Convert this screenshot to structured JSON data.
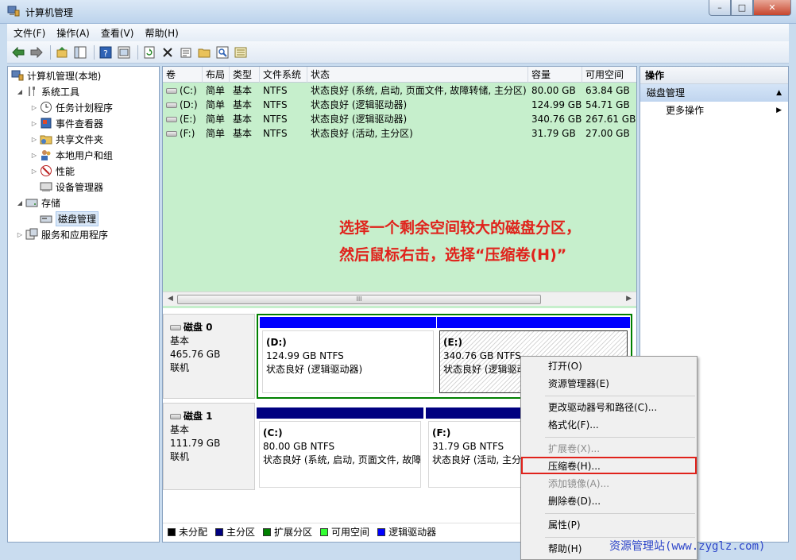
{
  "window": {
    "title": "计算机管理",
    "buttons": {
      "minimize": "–",
      "maximize": "□",
      "close": "✕"
    }
  },
  "menu": [
    "文件(F)",
    "操作(A)",
    "查看(V)",
    "帮助(H)"
  ],
  "toolbar": [
    "back-icon",
    "forward-icon",
    "up-icon",
    "console-tree-icon",
    "help-icon",
    "properties-icon",
    "refresh-icon",
    "delete-icon",
    "properties2-icon",
    "open-icon",
    "search-icon",
    "export-icon"
  ],
  "tree": {
    "root": "计算机管理(本地)",
    "system_tools": "系统工具",
    "task_scheduler": "任务计划程序",
    "event_viewer": "事件查看器",
    "shared_folders": "共享文件夹",
    "local_users": "本地用户和组",
    "performance": "性能",
    "device_manager": "设备管理器",
    "storage": "存储",
    "disk_management": "磁盘管理",
    "services_apps": "服务和应用程序"
  },
  "volumes": {
    "headers": [
      "卷",
      "布局",
      "类型",
      "文件系统",
      "状态",
      "容量",
      "可用空间"
    ],
    "rows": [
      [
        "(C:)",
        "简单",
        "基本",
        "NTFS",
        "状态良好 (系统, 启动, 页面文件, 故障转储, 主分区)",
        "80.00 GB",
        "63.84 GB"
      ],
      [
        "(D:)",
        "简单",
        "基本",
        "NTFS",
        "状态良好 (逻辑驱动器)",
        "124.99 GB",
        "54.71 GB"
      ],
      [
        "(E:)",
        "简单",
        "基本",
        "NTFS",
        "状态良好 (逻辑驱动器)",
        "340.76 GB",
        "267.61 GB"
      ],
      [
        "(F:)",
        "简单",
        "基本",
        "NTFS",
        "状态良好 (活动, 主分区)",
        "31.79 GB",
        "27.00 GB"
      ]
    ]
  },
  "note": {
    "line1": "选择一个剩余空间较大的磁盘分区，",
    "line2": "然后鼠标右击，选择“压缩卷(H)”"
  },
  "scroll_glyph": "III",
  "disks": [
    {
      "name": "磁盘 0",
      "type": "基本",
      "size": "465.76 GB",
      "status": "联机",
      "partitions": [
        {
          "label": "(D:)",
          "size": "124.99 GB NTFS",
          "status": "状态良好 (逻辑驱动器)"
        },
        {
          "label": "(E:)",
          "size": "340.76 GB NTFS",
          "status": "状态良好 (逻辑驱动器)"
        }
      ]
    },
    {
      "name": "磁盘 1",
      "type": "基本",
      "size": "111.79 GB",
      "status": "联机",
      "partitions": [
        {
          "label": "(C:)",
          "size": "80.00 GB NTFS",
          "status": "状态良好 (系统, 启动, 页面文件, 故障"
        },
        {
          "label": "(F:)",
          "size": "31.79 GB NTFS",
          "status": "状态良好 (活动, 主分"
        }
      ]
    }
  ],
  "legend": [
    {
      "label": "未分配",
      "color": "#000000"
    },
    {
      "label": "主分区",
      "color": "#000080"
    },
    {
      "label": "扩展分区",
      "color": "#008000"
    },
    {
      "label": "可用空间",
      "color": "#33ff33"
    },
    {
      "label": "逻辑驱动器",
      "color": "#0000ff"
    }
  ],
  "actions": {
    "header": "操作",
    "section": "磁盘管理",
    "more": "更多操作"
  },
  "context_menu": {
    "open": "打开(O)",
    "explorer": "资源管理器(E)",
    "change_letter": "更改驱动器号和路径(C)...",
    "format": "格式化(F)...",
    "extend": "扩展卷(X)...",
    "shrink": "压缩卷(H)...",
    "add_mirror": "添加镜像(A)...",
    "delete": "删除卷(D)...",
    "properties": "属性(P)",
    "help": "帮助(H)"
  },
  "watermark": "资源管理站(www.zyglz.com)",
  "colors": {
    "note": "#e0221b",
    "logical": "#0000ff",
    "primary": "#000080",
    "extended": "#008000",
    "selection": "#e0221b"
  }
}
